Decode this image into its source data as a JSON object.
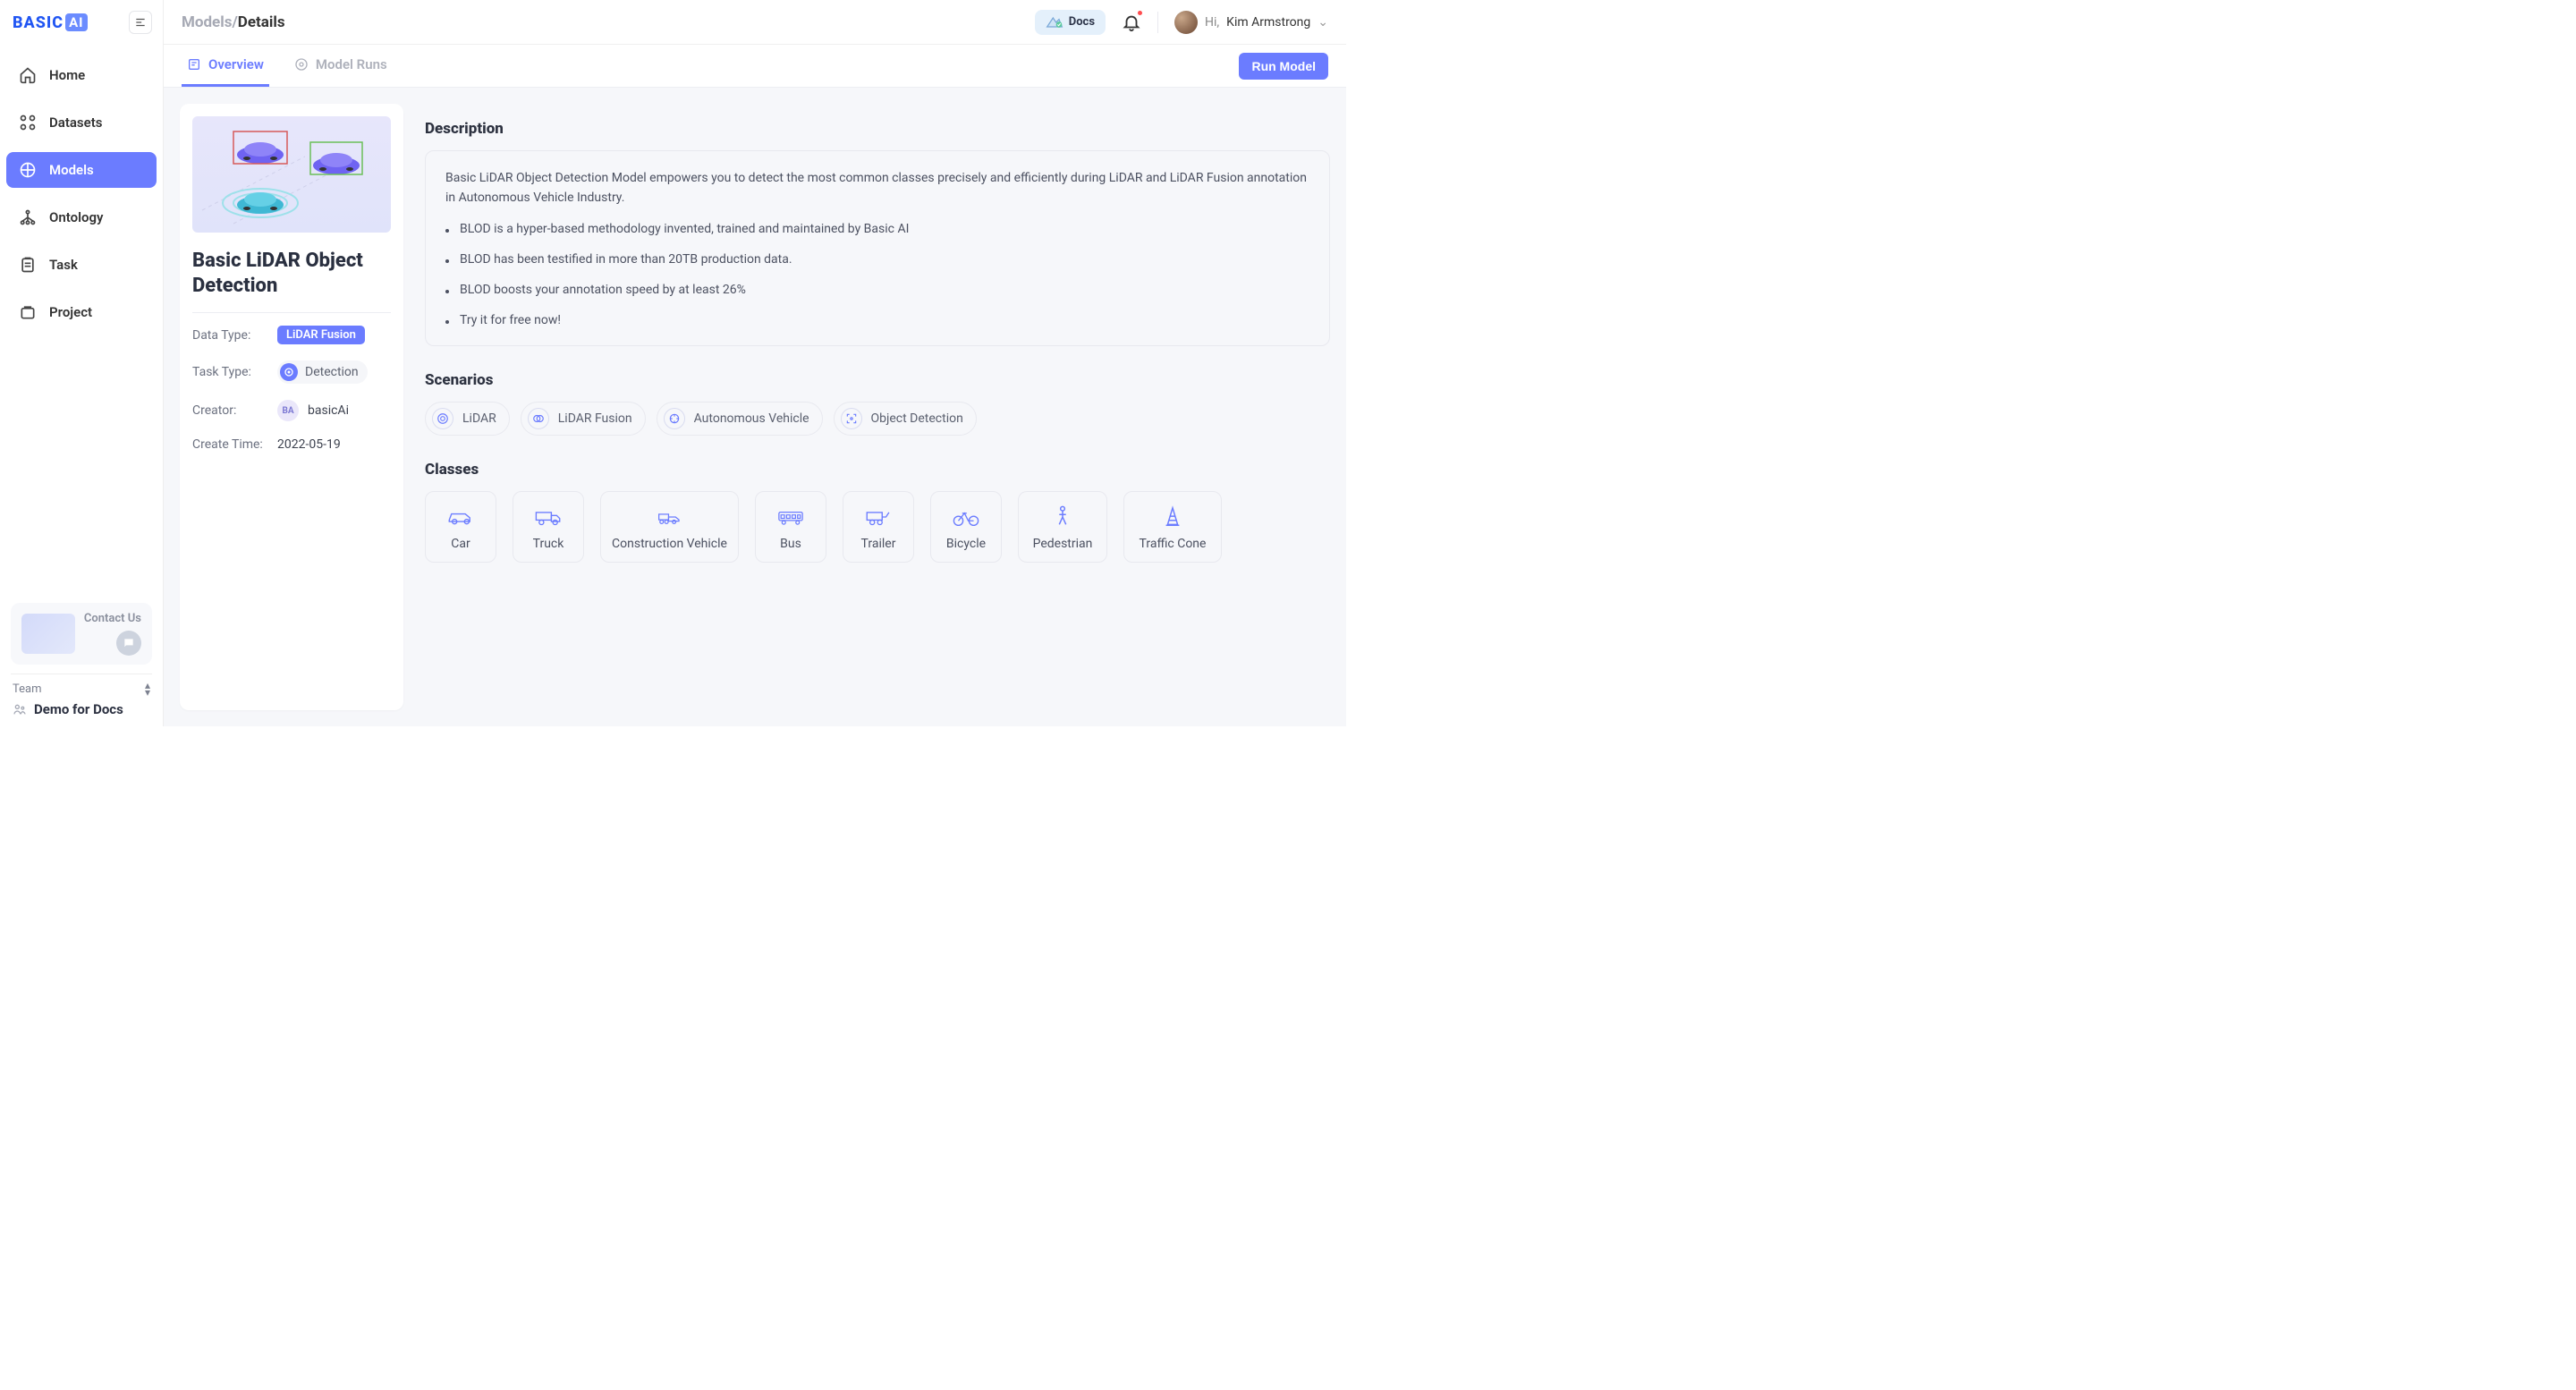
{
  "brand": {
    "part1": "BASIC",
    "part2": "AI"
  },
  "sidebar": {
    "items": [
      {
        "label": "Home"
      },
      {
        "label": "Datasets"
      },
      {
        "label": "Models"
      },
      {
        "label": "Ontology"
      },
      {
        "label": "Task"
      },
      {
        "label": "Project"
      }
    ],
    "contact": "Contact Us",
    "team_label": "Team",
    "team_name": "Demo for Docs"
  },
  "breadcrumb": {
    "root": "Models",
    "sep": "/",
    "current": "Details"
  },
  "topbar": {
    "docs": "Docs",
    "greeting": "Hi,",
    "username": "Kim Armstrong"
  },
  "tabs": [
    {
      "label": "Overview"
    },
    {
      "label": "Model Runs"
    }
  ],
  "run_button": "Run Model",
  "model": {
    "title": "Basic LiDAR Object Detection",
    "meta": {
      "data_type_label": "Data Type:",
      "data_type_value": "LiDAR Fusion",
      "task_type_label": "Task Type:",
      "task_type_value": "Detection",
      "creator_label": "Creator:",
      "creator_initials": "BA",
      "creator_value": "basicAi",
      "create_time_label": "Create Time:",
      "create_time_value": "2022-05-19"
    }
  },
  "description": {
    "title": "Description",
    "paragraph": "Basic LiDAR Object Detection Model empowers you to detect the most common classes precisely and efficiently during LiDAR and LiDAR Fusion annotation in Autonomous Vehicle Industry.",
    "bullets": [
      "BLOD is a hyper-based methodology invented, trained and maintained by Basic AI",
      "BLOD has been testified in more than 20TB production data.",
      "BLOD boosts your annotation speed by at least 26%",
      "Try it for free now!"
    ]
  },
  "scenarios": {
    "title": "Scenarios",
    "items": [
      "LiDAR",
      "LiDAR Fusion",
      "Autonomous Vehicle",
      "Object Detection"
    ]
  },
  "classes": {
    "title": "Classes",
    "items": [
      {
        "label": "Car",
        "cls": "c-car"
      },
      {
        "label": "Truck",
        "cls": "c-truck"
      },
      {
        "label": "Construction Vehicle",
        "cls": "wide"
      },
      {
        "label": "Bus",
        "cls": "c-bus"
      },
      {
        "label": "Trailer",
        "cls": "c-trailer"
      },
      {
        "label": "Bicycle",
        "cls": "c-bike"
      },
      {
        "label": "Pedestrian",
        "cls": "c-ped"
      },
      {
        "label": "Traffic Cone",
        "cls": "c-cone"
      }
    ]
  }
}
